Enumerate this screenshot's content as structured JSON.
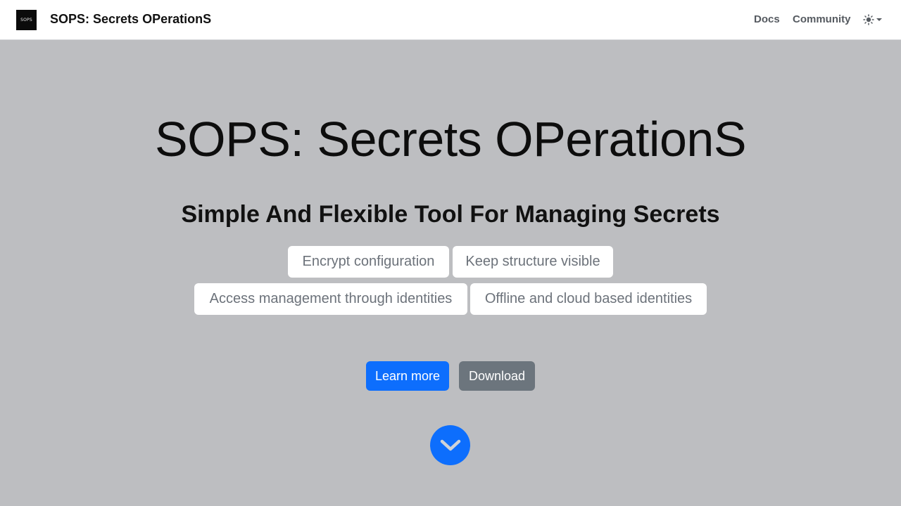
{
  "navbar": {
    "logo_text": "SOPS",
    "brand_title": "SOPS: Secrets OPerationS",
    "links": {
      "docs": "Docs",
      "community": "Community"
    },
    "theme_icon": "sun-icon"
  },
  "hero": {
    "title": "SOPS: Secrets OPerationS",
    "subtitle": "Simple And Flexible Tool For Managing Secrets",
    "features": [
      "Encrypt configuration",
      "Keep structure visible",
      "Access management through identities",
      "Offline and cloud based identities"
    ],
    "buttons": {
      "learn_more": "Learn more",
      "download": "Download"
    },
    "scroll_icon": "chevron-down-icon"
  },
  "colors": {
    "background": "#bdbec1",
    "primary": "#0d6efd",
    "secondary": "#6c757d"
  }
}
